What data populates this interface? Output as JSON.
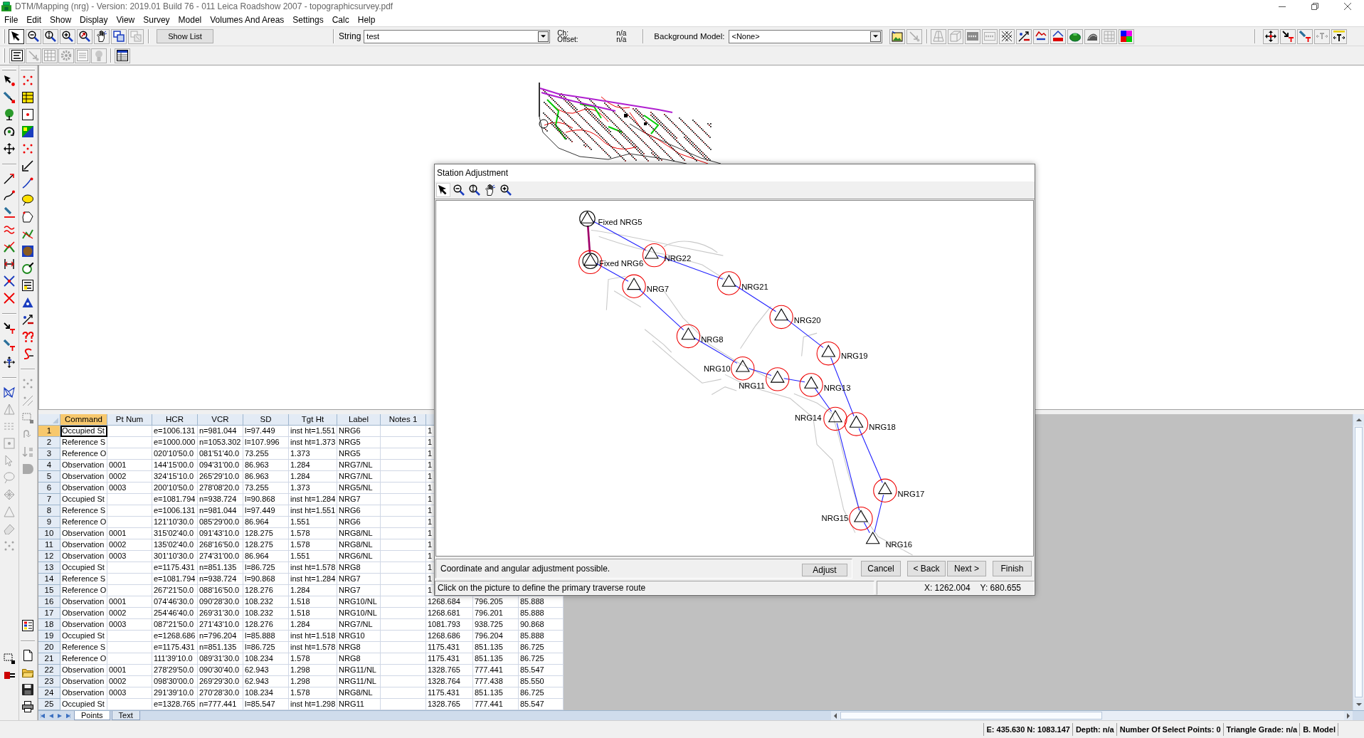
{
  "window": {
    "title": "DTM/Mapping (nrg) - Version: 2019.01 Build 76 - 011 Leica Roadshow 2007 - topographicsurvey.pdf"
  },
  "menu": [
    "File",
    "Edit",
    "Show",
    "Display",
    "View",
    "Survey",
    "Model",
    "Volumes And Areas",
    "Settings",
    "Calc",
    "Help"
  ],
  "toolbar": {
    "tools": [
      {
        "selected": true,
        "disabled": false
      },
      {
        "selected": false,
        "disabled": false
      },
      {
        "selected": false,
        "disabled": false
      },
      {
        "selected": false,
        "disabled": false
      },
      {
        "selected": false,
        "disabled": false
      },
      {
        "selected": false,
        "disabled": false
      },
      {
        "selected": false,
        "disabled": false
      },
      {
        "selected": false,
        "disabled": true
      }
    ],
    "show_list": "Show List",
    "string_label": "String",
    "string_value": "test",
    "ch_label": "Ch:",
    "ch_value": "n/a",
    "offset_label": "Offset:",
    "offset_value": "n/a",
    "background_model_label": "Background Model:",
    "background_model_value": "<None>",
    "model_tools": [
      {
        "disabled": false
      },
      {
        "disabled": true
      }
    ],
    "display_tools": [
      {
        "disabled": true
      },
      {
        "disabled": true
      },
      {
        "disabled": false
      },
      {
        "disabled": true
      },
      {
        "disabled": false
      },
      {
        "disabled": false
      },
      {
        "disabled": false
      },
      {
        "disabled": false
      },
      {
        "disabled": false
      },
      {
        "disabled": false
      },
      {
        "disabled": true
      },
      {
        "disabled": false
      }
    ],
    "text_tools": [
      {
        "disabled": false
      },
      {
        "disabled": false
      },
      {
        "disabled": false
      },
      {
        "disabled": true
      },
      {
        "disabled": false
      }
    ]
  },
  "toolbar_2": {
    "tools": [
      {
        "disabled": false
      },
      {
        "disabled": true
      },
      {
        "disabled": true
      },
      {
        "disabled": true
      },
      {
        "disabled": true
      },
      {
        "disabled": true
      },
      {
        "disabled": false
      }
    ]
  },
  "left_toolbar": {
    "column_1": [
      {
        "disabled": false
      },
      {
        "disabled": false
      },
      {
        "disabled": false
      },
      {
        "disabled": false
      },
      {
        "disabled": false
      },
      {
        "disabled": false
      },
      {
        "disabled": false
      },
      {
        "disabled": false
      },
      {
        "disabled": false
      },
      {
        "disabled": false
      },
      {
        "disabled": false
      },
      {
        "disabled": false
      },
      {
        "disabled": false
      },
      {
        "disabled": false
      },
      {
        "disabled": false
      },
      {
        "disabled": false
      },
      {
        "disabled": false
      },
      {
        "disabled": true
      },
      {
        "disabled": true
      },
      {
        "disabled": true
      },
      {
        "disabled": true
      },
      {
        "disabled": true
      },
      {
        "disabled": true
      },
      {
        "disabled": true
      },
      {
        "disabled": true
      },
      {
        "disabled": true
      },
      {
        "disabled": false
      },
      {
        "disabled": false
      }
    ],
    "column_2": [
      {
        "disabled": false
      },
      {
        "disabled": false
      },
      {
        "disabled": false
      },
      {
        "disabled": false
      },
      {
        "disabled": false
      },
      {
        "disabled": false
      },
      {
        "disabled": false
      },
      {
        "disabled": false
      },
      {
        "disabled": false
      },
      {
        "disabled": false
      },
      {
        "disabled": false
      },
      {
        "disabled": false
      },
      {
        "disabled": false
      },
      {
        "disabled": false
      },
      {
        "disabled": false
      },
      {
        "disabled": false
      },
      {
        "disabled": false
      },
      {
        "disabled": true
      },
      {
        "disabled": true
      },
      {
        "disabled": true
      },
      {
        "disabled": true
      },
      {
        "disabled": true
      },
      {
        "disabled": true
      },
      {
        "disabled": false
      },
      {
        "disabled": false
      },
      {
        "disabled": false
      },
      {
        "disabled": false
      },
      {
        "disabled": false
      }
    ]
  },
  "table": {
    "columns": [
      {
        "label": "Command",
        "selected": true
      },
      {
        "label": "Pt Num",
        "selected": false
      },
      {
        "label": "HCR",
        "selected": false
      },
      {
        "label": "VCR",
        "selected": false
      },
      {
        "label": "SD",
        "selected": false
      },
      {
        "label": "Tgt Ht",
        "selected": false
      },
      {
        "label": "Label",
        "selected": false
      },
      {
        "label": "Notes 1",
        "selected": false
      }
    ],
    "rows": [
      {
        "n": "1",
        "selected": true,
        "command": "Occupied St",
        "hcr": "e=1006.131",
        "vcr": "n=981.044",
        "sd": "l=97.449",
        "tgt_ht": "inst ht=1.551",
        "label": "NRG6",
        "column_9": "1"
      },
      {
        "n": "2",
        "selected": false,
        "command": "Reference S",
        "hcr": "e=1000.000",
        "vcr": "n=1053.302",
        "sd": "l=107.996",
        "tgt_ht": "inst ht=1.373",
        "label": "NRG5",
        "column_9": "1"
      },
      {
        "n": "3",
        "selected": false,
        "command": "Reference O",
        "hcr": "020'10'50.0",
        "vcr": "081'51'40.0",
        "sd": "73.255",
        "tgt_ht": "1.373",
        "label": "NRG5",
        "column_9": "1"
      },
      {
        "n": "4",
        "selected": false,
        "command": "Observation",
        "pt_num": "0001",
        "hcr": "144'15'00.0",
        "vcr": "094'31'00.0",
        "sd": "86.963",
        "tgt_ht": "1.284",
        "label": "NRG7/NL",
        "column_9": "1"
      },
      {
        "n": "5",
        "selected": false,
        "command": "Observation",
        "pt_num": "0002",
        "hcr": "324'15'10.0",
        "vcr": "265'29'10.0",
        "sd": "86.963",
        "tgt_ht": "1.284",
        "label": "NRG7/NL",
        "column_9": "1"
      },
      {
        "n": "6",
        "selected": false,
        "command": "Observation",
        "pt_num": "0003",
        "hcr": "200'10'50.0",
        "vcr": "278'08'20.0",
        "sd": "73.255",
        "tgt_ht": "1.373",
        "label": "NRG5/NL",
        "column_9": "1"
      },
      {
        "n": "7",
        "selected": false,
        "command": "Occupied St",
        "hcr": "e=1081.794",
        "vcr": "n=938.724",
        "sd": "l=90.868",
        "tgt_ht": "inst ht=1.284",
        "label": "NRG7",
        "column_9": "1"
      },
      {
        "n": "8",
        "selected": false,
        "command": "Reference S",
        "hcr": "e=1006.131",
        "vcr": "n=981.044",
        "sd": "l=97.449",
        "tgt_ht": "inst ht=1.551",
        "label": "NRG6",
        "column_9": "1"
      },
      {
        "n": "9",
        "selected": false,
        "command": "Reference O",
        "hcr": "121'10'30.0",
        "vcr": "085'29'00.0",
        "sd": "86.964",
        "tgt_ht": "1.551",
        "label": "NRG6",
        "column_9": "1"
      },
      {
        "n": "10",
        "selected": false,
        "command": "Observation",
        "pt_num": "0001",
        "hcr": "315'02'40.0",
        "vcr": "091'43'10.0",
        "sd": "128.275",
        "tgt_ht": "1.578",
        "label": "NRG8/NL",
        "column_9": "1"
      },
      {
        "n": "11",
        "selected": false,
        "command": "Observation",
        "pt_num": "0002",
        "hcr": "135'02'40.0",
        "vcr": "268'16'50.0",
        "sd": "128.275",
        "tgt_ht": "1.578",
        "label": "NRG8/NL",
        "column_9": "1"
      },
      {
        "n": "12",
        "selected": false,
        "command": "Observation",
        "pt_num": "0003",
        "hcr": "301'10'30.0",
        "vcr": "274'31'00.0",
        "sd": "86.964",
        "tgt_ht": "1.551",
        "label": "NRG6/NL",
        "column_9": "1"
      },
      {
        "n": "13",
        "selected": false,
        "command": "Occupied St",
        "hcr": "e=1175.431",
        "vcr": "n=851.135",
        "sd": "l=86.725",
        "tgt_ht": "inst ht=1.578",
        "label": "NRG8",
        "column_9": "1"
      },
      {
        "n": "14",
        "selected": false,
        "command": "Reference S",
        "hcr": "e=1081.794",
        "vcr": "n=938.724",
        "sd": "l=90.868",
        "tgt_ht": "inst ht=1.284",
        "label": "NRG7",
        "column_9": "1"
      },
      {
        "n": "15",
        "selected": false,
        "command": "Reference O",
        "hcr": "267'21'50.0",
        "vcr": "088'16'50.0",
        "sd": "128.276",
        "tgt_ht": "1.284",
        "label": "NRG7",
        "column_9": "1"
      },
      {
        "n": "16",
        "selected": false,
        "command": "Observation",
        "pt_num": "0001",
        "hcr": "074'46'30.0",
        "vcr": "090'28'30.0",
        "sd": "108.232",
        "tgt_ht": "1.518",
        "label": "NRG10/NL",
        "column_9": "1268.684",
        "column_10": "796.205",
        "column_11": "85.888"
      },
      {
        "n": "17",
        "selected": false,
        "command": "Observation",
        "pt_num": "0002",
        "hcr": "254'46'40.0",
        "vcr": "269'31'30.0",
        "sd": "108.232",
        "tgt_ht": "1.518",
        "label": "NRG10/NL",
        "column_9": "1268.681",
        "column_10": "796.201",
        "column_11": "85.888"
      },
      {
        "n": "18",
        "selected": false,
        "command": "Observation",
        "pt_num": "0003",
        "hcr": "087'21'50.0",
        "vcr": "271'43'10.0",
        "sd": "128.276",
        "tgt_ht": "1.284",
        "label": "NRG7/NL",
        "column_9": "1081.793",
        "column_10": "938.725",
        "column_11": "90.868"
      },
      {
        "n": "19",
        "selected": false,
        "command": "Occupied St",
        "hcr": "e=1268.686",
        "vcr": "n=796.204",
        "sd": "l=85.888",
        "tgt_ht": "inst ht=1.518",
        "label": "NRG10",
        "column_9": "1268.686",
        "column_10": "796.204",
        "column_11": "85.888"
      },
      {
        "n": "20",
        "selected": false,
        "command": "Reference S",
        "hcr": "e=1175.431",
        "vcr": "n=851.135",
        "sd": "l=86.725",
        "tgt_ht": "inst ht=1.578",
        "label": "NRG8",
        "column_9": "1175.431",
        "column_10": "851.135",
        "column_11": "86.725"
      },
      {
        "n": "21",
        "selected": false,
        "command": "Reference O",
        "hcr": "111'39'10.0",
        "vcr": "089'31'30.0",
        "sd": "108.234",
        "tgt_ht": "1.578",
        "label": "NRG8",
        "column_9": "1175.431",
        "column_10": "851.135",
        "column_11": "86.725"
      },
      {
        "n": "22",
        "selected": false,
        "command": "Observation",
        "pt_num": "0001",
        "hcr": "278'29'50.0",
        "vcr": "090'30'40.0",
        "sd": "62.943",
        "tgt_ht": "1.298",
        "label": "NRG11/NL",
        "column_9": "1328.765",
        "column_10": "777.441",
        "column_11": "85.547"
      },
      {
        "n": "23",
        "selected": false,
        "command": "Observation",
        "pt_num": "0002",
        "hcr": "098'30'00.0",
        "vcr": "269'29'30.0",
        "sd": "62.943",
        "tgt_ht": "1.298",
        "label": "NRG11/NL",
        "column_9": "1328.764",
        "column_10": "777.438",
        "column_11": "85.550"
      },
      {
        "n": "24",
        "selected": false,
        "command": "Observation",
        "pt_num": "0003",
        "hcr": "291'39'10.0",
        "vcr": "270'28'30.0",
        "sd": "108.234",
        "tgt_ht": "1.578",
        "label": "NRG8/NL",
        "column_9": "1175.431",
        "column_10": "851.135",
        "column_11": "86.725"
      },
      {
        "n": "25",
        "selected": false,
        "command": "Occupied St",
        "hcr": "e=1328.765",
        "vcr": "n=777.441",
        "sd": "l=85.547",
        "tgt_ht": "inst ht=1.298",
        "label": "NRG11",
        "column_9": "1328.765",
        "column_10": "777.441",
        "column_11": "85.547"
      }
    ]
  },
  "sheet_tabs": [
    {
      "label": "Points",
      "selected": true
    },
    {
      "label": "Text",
      "selected": false
    }
  ],
  "status_bar": [
    "E: 435.630 N: 1083.147",
    "Depth: n/a",
    "Number Of Select Points: 0",
    "Triangle Grade: n/a",
    "B. Model"
  ],
  "dialog": {
    "title": "Station Adjustment",
    "tools": [
      {
        "selected": true
      },
      {
        "selected": false
      },
      {
        "selected": false
      },
      {
        "selected": false
      },
      {
        "selected": false
      }
    ],
    "stations": [
      {
        "label": "Fixed NRG5",
        "kind": "fixed",
        "error_circle": false
      },
      {
        "label": "Fixed NRG6",
        "kind": "fixed",
        "error_circle": true
      },
      {
        "label": "NRG22",
        "kind": "traverse",
        "error_circle": true
      },
      {
        "label": "NRG7",
        "kind": "traverse",
        "error_circle": true
      },
      {
        "label": "NRG21",
        "kind": "traverse",
        "error_circle": true
      },
      {
        "label": "NRG20",
        "kind": "traverse",
        "error_circle": true
      },
      {
        "label": "NRG8",
        "kind": "traverse",
        "error_circle": true
      },
      {
        "label": "NRG19",
        "kind": "traverse",
        "error_circle": true
      },
      {
        "label": "NRG10",
        "kind": "traverse",
        "error_circle": true
      },
      {
        "label": "NRG11",
        "kind": "traverse",
        "error_circle": true
      },
      {
        "label": "NRG13",
        "kind": "traverse",
        "error_circle": true
      },
      {
        "label": "NRG14",
        "kind": "traverse",
        "error_circle": true
      },
      {
        "label": "NRG18",
        "kind": "traverse",
        "error_circle": true
      },
      {
        "label": "NRG17",
        "kind": "traverse",
        "error_circle": true
      },
      {
        "label": "NRG15",
        "kind": "traverse",
        "error_circle": true
      },
      {
        "label": "NRG16",
        "kind": "traverse",
        "error_circle": false
      }
    ],
    "message": "Coordinate and angular adjustment possible.",
    "adjust_button": "Adjust",
    "buttons": [
      "Cancel",
      "< Back",
      "Next >",
      "Finish"
    ],
    "hint": "Click on the picture to define the primary traverse route",
    "coordinates": [
      "X: 1262.004",
      "Y: 680.655"
    ]
  }
}
